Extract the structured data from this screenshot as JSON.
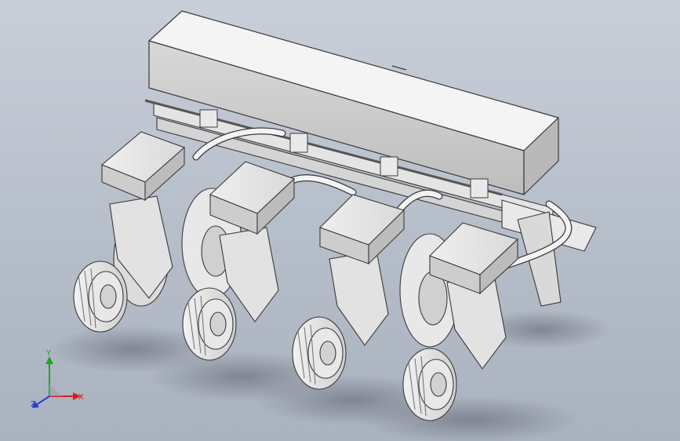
{
  "viewport": {
    "background_top": "#c9cfd9",
    "background_bottom": "#aab2bf"
  },
  "model": {
    "part_color": "#e6e6e6",
    "edge_color": "#3a3a3a",
    "shadow_color": "#6f7682"
  },
  "triad": {
    "x_label": "X",
    "y_label": "Y",
    "z_label": "Z",
    "x_color": "#d62020",
    "y_color": "#1fa51f",
    "z_color": "#2140d6"
  }
}
